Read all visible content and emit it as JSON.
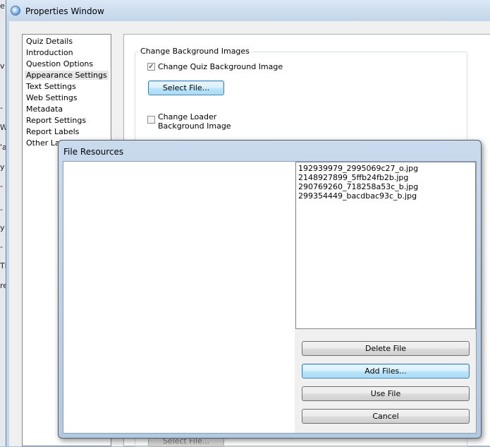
{
  "window": {
    "title": "Properties Window"
  },
  "background": {
    "edge_fragments": [
      "e",
      "v",
      "-",
      "W",
      "'a",
      "y",
      "-",
      "-",
      "y",
      "-",
      "Th",
      "re"
    ]
  },
  "nav": {
    "items": [
      {
        "label": "Quiz Details",
        "selected": false
      },
      {
        "label": "Introduction",
        "selected": false
      },
      {
        "label": "Question Options",
        "selected": false
      },
      {
        "label": "Appearance Settings",
        "selected": true
      },
      {
        "label": "Text Settings",
        "selected": false
      },
      {
        "label": "Web Settings",
        "selected": false
      },
      {
        "label": "Metadata",
        "selected": false
      },
      {
        "label": "Report Settings",
        "selected": false
      },
      {
        "label": "Report Labels",
        "selected": false
      },
      {
        "label": "Other Labels",
        "selected": false
      }
    ]
  },
  "appearance": {
    "group_title": "Change Background Images",
    "quiz_bg_checkbox": {
      "label": "Change Quiz Background Image",
      "checked": true,
      "mark": "✓"
    },
    "select_file_label": "Select File...",
    "loader_bg_checkbox": {
      "label": "Change Loader Background Image",
      "checked": false
    },
    "select_file_bottom_label": "Select File..."
  },
  "file_dialog": {
    "title": "File Resources",
    "files": [
      "192939979_2995069c27_o.jpg",
      "2148927899_5ffb24fb2b.jpg",
      "290769260_718258a53c_b.jpg",
      "299354449_bacdbac93c_b.jpg"
    ],
    "buttons": {
      "delete": "Delete File",
      "add": "Add Files...",
      "use": "Use File",
      "cancel": "Cancel"
    }
  },
  "colors": {
    "dialog_frame": "#b2c9e2",
    "focus_button": "#3c7fb1"
  }
}
